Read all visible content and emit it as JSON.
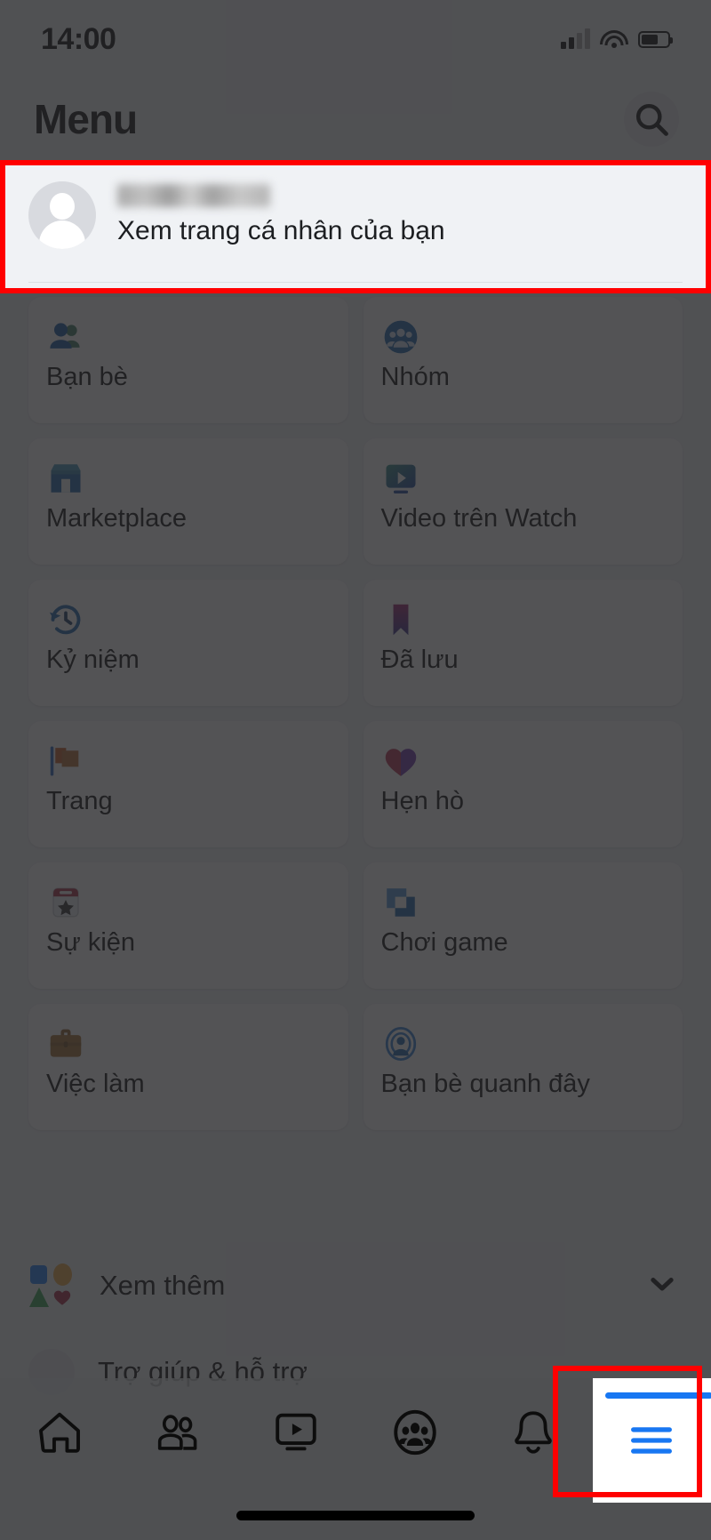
{
  "status_bar": {
    "time": "14:00",
    "signal_icon": "cellular-signal-icon",
    "signal_bars_filled": 2,
    "signal_bars_total": 4,
    "wifi_icon": "wifi-icon",
    "battery_icon": "battery-icon",
    "battery_percent": 62
  },
  "header": {
    "title": "Menu",
    "search_icon": "search-icon"
  },
  "profile": {
    "name": "",
    "name_blurred": true,
    "subtitle": "Xem trang cá nhân của bạn",
    "avatar_icon": "default-avatar-icon",
    "highlighted": true
  },
  "colors": {
    "page_background": "#f0f2f5",
    "card_background": "#ffffff",
    "primary_text": "#050505",
    "accent_blue": "#1877f2",
    "highlight_red": "#ff0000",
    "dim_overlay": "rgba(40,40,42,0.80)"
  },
  "grid": {
    "items": [
      {
        "label": "Bạn bè",
        "icon": "friends-icon"
      },
      {
        "label": "Nhóm",
        "icon": "groups-icon"
      },
      {
        "label": "Marketplace",
        "icon": "marketplace-icon"
      },
      {
        "label": "Video trên Watch",
        "icon": "watch-video-icon"
      },
      {
        "label": "Kỷ niệm",
        "icon": "memories-clock-icon"
      },
      {
        "label": "Đã lưu",
        "icon": "saved-bookmark-icon"
      },
      {
        "label": "Trang",
        "icon": "pages-flag-icon"
      },
      {
        "label": "Hẹn hò",
        "icon": "dating-heart-icon"
      },
      {
        "label": "Sự kiện",
        "icon": "events-calendar-star-icon"
      },
      {
        "label": "Chơi game",
        "icon": "gaming-icon"
      },
      {
        "label": "Việc làm",
        "icon": "jobs-briefcase-icon"
      },
      {
        "label": "Bạn bè quanh đây",
        "icon": "nearby-friends-icon"
      }
    ]
  },
  "see_more": {
    "label": "Xem thêm",
    "icon": "shapes-icon",
    "chevron_icon": "chevron-down-icon"
  },
  "partial_row": {
    "label": "Trợ giúp & hỗ trợ",
    "icon": "help-support-icon"
  },
  "bottom_nav": {
    "items": [
      {
        "name": "home",
        "icon": "home-icon",
        "active": false
      },
      {
        "name": "friends",
        "icon": "friends-outline-icon",
        "active": false
      },
      {
        "name": "watch",
        "icon": "watch-icon",
        "active": false
      },
      {
        "name": "groups",
        "icon": "groups-outline-icon",
        "active": false
      },
      {
        "name": "notifications",
        "icon": "bell-icon",
        "active": false
      },
      {
        "name": "menu",
        "icon": "hamburger-menu-icon",
        "active": true
      }
    ],
    "active_index": 5,
    "highlighted": true
  }
}
